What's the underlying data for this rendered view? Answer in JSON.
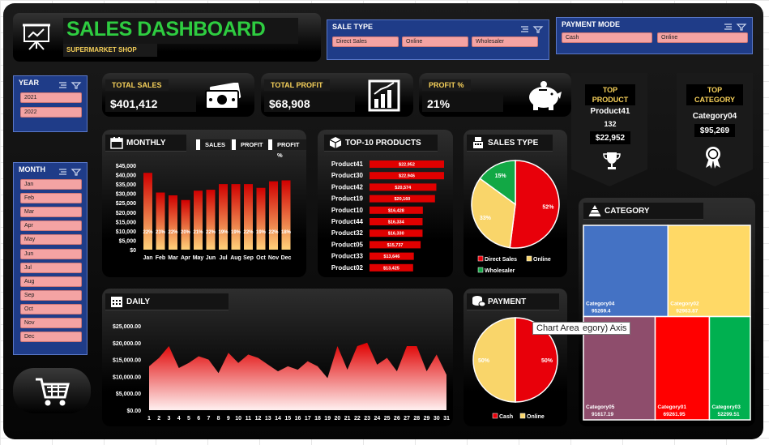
{
  "title": "SALES DASHBOARD",
  "subtitle": "SUPERMARKET SHOP",
  "slicers": {
    "sale_type": {
      "title": "SALE TYPE",
      "items": [
        "Direct Sales",
        "Online",
        "Wholesaler"
      ]
    },
    "payment_mode": {
      "title": "PAYMENT MODE",
      "items": [
        "Cash",
        "Online"
      ]
    },
    "year": {
      "title": "YEAR",
      "items": [
        "2021",
        "2022"
      ]
    },
    "month": {
      "title": "MONTH",
      "items": [
        "Jan",
        "Feb",
        "Mar",
        "Apr",
        "May",
        "Jun",
        "Jul",
        "Aug",
        "Sep",
        "Oct",
        "Nov",
        "Dec"
      ]
    }
  },
  "kpis": {
    "total_sales": {
      "label": "TOTAL SALES",
      "value": "$401,412"
    },
    "total_profit": {
      "label": "TOTAL PROFIT",
      "value": "$68,908"
    },
    "profit_pct": {
      "label": "PROFIT %",
      "value": "21%"
    }
  },
  "top_product": {
    "title_line1": "TOP",
    "title_line2": "PRODUCT",
    "name": "Product41",
    "count": "132",
    "value": "$22,952"
  },
  "top_category": {
    "title_line1": "TOP",
    "title_line2": "CATEGORY",
    "name": "Category04",
    "value": "$95,269"
  },
  "monthly": {
    "title": "MONTHLY",
    "buttons": [
      "SALES",
      "PROFIT",
      "PROFIT %"
    ]
  },
  "top10": {
    "title": "TOP-10 PRODUCTS"
  },
  "sales_type": {
    "title": "SALES TYPE"
  },
  "daily": {
    "title": "DAILY"
  },
  "payment": {
    "title": "PAYMENT"
  },
  "category": {
    "title": "CATEGORY"
  },
  "tooltip": {
    "text": "Chart Area",
    "overlay": "egory) Axis"
  },
  "colors": {
    "title_green": "#2ecc40",
    "accent_gold": "#f7d15a",
    "bar_red": "#e00000",
    "slicer_blue": "#1f3c88",
    "pill_pink": "#f4a3a3"
  },
  "chart_data": [
    {
      "type": "bar",
      "id": "monthly",
      "categories": [
        "Jan",
        "Feb",
        "Mar",
        "Apr",
        "May",
        "Jun",
        "Jul",
        "Aug",
        "Sep",
        "Oct",
        "Nov",
        "Dec"
      ],
      "values": [
        41000,
        30500,
        29000,
        26500,
        31500,
        32000,
        35000,
        35000,
        35000,
        33000,
        36500,
        37000
      ],
      "bar_labels": [
        "22%",
        "23%",
        "22%",
        "20%",
        "21%",
        "22%",
        "19%",
        "19%",
        "22%",
        "19%",
        "22%",
        "18%"
      ],
      "yticks": [
        "$45,000",
        "$40,000",
        "$35,000",
        "$30,000",
        "$25,000",
        "$20,000",
        "$15,000",
        "$10,000",
        "$5,000",
        "$0"
      ],
      "ylim": [
        0,
        45000
      ]
    },
    {
      "type": "bar",
      "id": "top10",
      "orientation": "horizontal",
      "categories": [
        "Product41",
        "Product30",
        "Product42",
        "Product19",
        "Product10",
        "Product44",
        "Product32",
        "Product05",
        "Product33",
        "Product02"
      ],
      "values": [
        22952,
        22946,
        20574,
        20160,
        16428,
        16334,
        16330,
        15737,
        13646,
        13425
      ],
      "labels": [
        "$22,952",
        "$22,946",
        "$20,574",
        "$20,160",
        "$16,428",
        "$16,334",
        "$16,330",
        "$15,737",
        "$13,646",
        "$13,425"
      ]
    },
    {
      "type": "pie",
      "id": "sales_type",
      "series": [
        {
          "name": "Direct Sales",
          "value": 52,
          "label": "52%",
          "color": "#e8000a"
        },
        {
          "name": "Online",
          "value": 33,
          "label": "33%",
          "color": "#f9d56a"
        },
        {
          "name": "Wholesaler",
          "value": 15,
          "label": "15%",
          "color": "#12a845"
        }
      ]
    },
    {
      "type": "pie",
      "id": "payment",
      "series": [
        {
          "name": "Cash",
          "value": 50,
          "label": "50%",
          "color": "#e8000a"
        },
        {
          "name": "Online",
          "value": 50,
          "label": "50%",
          "color": "#f9d56a"
        }
      ]
    },
    {
      "type": "area",
      "id": "daily",
      "x": [
        "1",
        "2",
        "3",
        "4",
        "5",
        "6",
        "7",
        "8",
        "9",
        "10",
        "11",
        "12",
        "13",
        "14",
        "15",
        "16",
        "17",
        "18",
        "19",
        "20",
        "21",
        "22",
        "23",
        "24",
        "25",
        "26",
        "27",
        "28",
        "29",
        "30",
        "31"
      ],
      "values": [
        13000,
        15500,
        19000,
        12500,
        14000,
        16000,
        15000,
        11000,
        17000,
        14000,
        16500,
        15500,
        13500,
        11500,
        13000,
        12000,
        14500,
        13000,
        9500,
        19000,
        12000,
        19000,
        20000,
        13500,
        15500,
        11500,
        19000,
        19000,
        11500,
        16500,
        10500
      ],
      "yticks": [
        "$25,000.00",
        "$20,000.00",
        "$15,000.00",
        "$10,000.00",
        "$5,000.00",
        "$0.00"
      ],
      "ylim": [
        0,
        25000
      ]
    },
    {
      "type": "treemap",
      "id": "category",
      "series": [
        {
          "name": "Category04",
          "value": 95269.4,
          "label": "95269.4",
          "color": "#4472c4"
        },
        {
          "name": "Category02",
          "value": 92963.87,
          "label": "92963.87",
          "color": "#ffd966"
        },
        {
          "name": "Category05",
          "value": 91617.19,
          "label": "91617.19",
          "color": "#8e4d6c"
        },
        {
          "name": "Category01",
          "value": 69261.95,
          "label": "69261.95",
          "color": "#ff0000"
        },
        {
          "name": "Category03",
          "value": 52299.51,
          "label": "52299.51",
          "color": "#00b050"
        }
      ]
    }
  ]
}
